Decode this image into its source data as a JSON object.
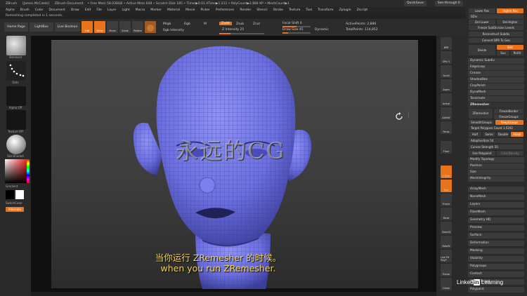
{
  "titlebar": {
    "app": "ZBrush",
    "user": "[James McCaleb]",
    "doc": "ZBrush Document",
    "mem": "• Free Mem 58.038GB • Active Mem 648 • Scratch Disk 185 • Timer▶0.01 ATime▶1.211 • PolyCount▶2.884 KP • MeshCount▶1",
    "quicksave": "QuickSave",
    "seethrough": "See-through 0",
    "menus": "Menus",
    "script": "DefaultZScript"
  },
  "menubar": [
    "Alpha",
    "Brush",
    "Color",
    "Document",
    "Draw",
    "Edit",
    "File",
    "Layer",
    "Light",
    "Macro",
    "Marker",
    "Material",
    "Movie",
    "Picker",
    "Preferences",
    "Render",
    "Stencil",
    "Stroke",
    "Texture",
    "Tool",
    "Transform",
    "Zplugin",
    "Zscript"
  ],
  "notice": "Remeshing completed in 1 seconds.",
  "toolbar": {
    "home": "Home Page",
    "lightbox": "LightBox",
    "liveboolean": "Live Boolean",
    "edit": "Edit",
    "draw": "Draw",
    "move": "Move",
    "scale": "Scale",
    "rotate": "Rotate",
    "mrgb": "Mrgb",
    "rgb": "Rgb",
    "m": "M",
    "zadd": "Zadd",
    "zsub": "Zsub",
    "zcut": "Zcut",
    "rgb_intensity": "Rgb Intensity",
    "z_intensity": "Z Intensity 25",
    "focal_shift": "Focal Shift 0",
    "draw_size": "Draw Size 45",
    "dynamic": "Dynamic",
    "active_points": "ActivePoints: 2,886",
    "total_points": "TotalPoints: 114,852"
  },
  "left_shelf": {
    "standard": "Standard",
    "dots": "Dots",
    "alpha_off": "Alpha Off",
    "texture_off": "Texture Off",
    "material": "SkinShade4",
    "gradient": "Gradient",
    "switch_color": "SwitchColor",
    "alternate": "Alternate"
  },
  "right_shelf": [
    "BPR",
    "SPix 3",
    "Scroll",
    "Zoom",
    "Actual",
    "AAHalf",
    "Persp",
    "Floor",
    "L.Sym",
    "Xyz",
    "Frame",
    "Move",
    "ZoomD",
    "RotaTe",
    "Line Fill PolyF",
    "Transp",
    "Ghost",
    "Solo",
    "Xpose"
  ],
  "panel": {
    "lower_res": "Lower Res",
    "higher_res": "Higher Res",
    "sdiv": "SDiv",
    "del_lower": "Del Lower",
    "del_higher": "Del Higher",
    "freeze_sub": "Freeze SubDivision Levels",
    "reconstruct": "Reconstruct Subdiv",
    "convert_bpr": "Convert BPR To Geo",
    "divide": "Divide",
    "smt": "Smt",
    "suv": "Suv",
    "relax": "ReUV",
    "dynamic_subdiv": "Dynamic Subdiv",
    "items_a": [
      "EdgeLoop",
      "Crease",
      "ShadowBox",
      "ClayPolish",
      "DynaMesh",
      "Tessimate"
    ],
    "zremesher_head": "ZRemesher",
    "zremesher_btn": "ZRemesher",
    "freeze_border": "FreezeBorder",
    "freeze_groups": "FreezeGroups",
    "smooth_groups": "SmoothGroups",
    "keep_groups": "KeepGroups",
    "target_count": "Target Polygons Count 1.5242",
    "half": "Half",
    "same": "Same",
    "double": "Double",
    "adapt": "Adapt",
    "adaptive_size": "AdaptiveSize 50",
    "curves_strength": "Curves Strength 50",
    "use_polypaint": "Use Polypaint",
    "colordensity": "ColorDensity",
    "items_b": [
      "Modify Topology",
      "Position",
      "Size",
      "MeshIntegrity"
    ],
    "items_c": [
      "ArrayMesh",
      "NanoMesh",
      "Layers",
      "FiberMesh",
      "Geometry HD",
      "Preview",
      "Surface",
      "Deformation",
      "Masking",
      "Visibility",
      "Polygroups",
      "Contact",
      "Morph Target",
      "Polypaint"
    ]
  },
  "subtitles": {
    "cn": "当你运行 ZRemesher 的时候。",
    "en": "when you run ZRemesher."
  },
  "watermark": "永远的CG",
  "brand": {
    "a": "Linked",
    "b": "in",
    "c": " Learning"
  },
  "colors": {
    "accent": "#e8731a",
    "mesh": "#6b6fe0",
    "subtitle": "#f3d35b"
  }
}
